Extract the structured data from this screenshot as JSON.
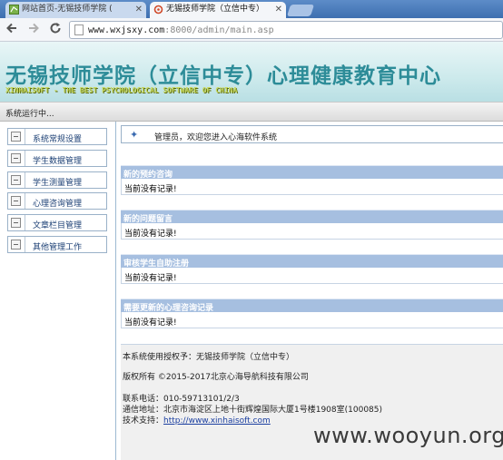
{
  "tabs": [
    {
      "label": "网站首页-无锡技师学院 (",
      "active": false
    },
    {
      "label": "无锡技师学院（立信中专）",
      "active": true
    }
  ],
  "toolbar": {
    "back_icon": "back-arrow-icon",
    "forward_icon": "forward-arrow-icon",
    "reload_icon": "reload-icon",
    "url_host": "www.wxjsxy.com",
    "url_rest": ":8000/admin/main.asp"
  },
  "banner": {
    "title": "无锡技师学院（立信中专）心理健康教育中心",
    "subtitle": "XINHAISOFT - THE BEST PSYCHOLOGICAL SOFTWARE OF CHINA"
  },
  "status": {
    "text": "系统运行中..."
  },
  "sidebar": {
    "items": [
      {
        "label": "系统常规设置"
      },
      {
        "label": "学生数据管理"
      },
      {
        "label": "学生测量管理"
      },
      {
        "label": "心理咨询管理"
      },
      {
        "label": "文章栏目管理"
      },
      {
        "label": "其他管理工作"
      }
    ]
  },
  "main": {
    "welcome": "管理员，欢迎您进入心海软件系统",
    "sections": [
      {
        "title": "新的预约咨询",
        "body": "当前没有记录!"
      },
      {
        "title": "新的问题留言",
        "body": "当前没有记录!"
      },
      {
        "title": "审核学生自助注册",
        "body": "当前没有记录!"
      },
      {
        "title": "需要更新的心理咨询记录",
        "body": "当前没有记录!"
      }
    ]
  },
  "footer": {
    "license": "本系统使用授权予：无锡技师学院（立信中专）",
    "copyright": "版权所有 ©2015-2017北京心海导航科技有限公司",
    "phone": "联系电话：010-59713101/2/3",
    "address": "通信地址：北京市海淀区上地十街辉煌国际大厦1号楼1908室(100085)",
    "support_label": "技术支持：",
    "support_link": "http://www.xinhaisoft.com"
  },
  "watermark": "www.wooyun.org",
  "colors": {
    "banner_title": "#2d8c98",
    "section_header": "#a6bfe0",
    "link": "#1b3fa0"
  }
}
